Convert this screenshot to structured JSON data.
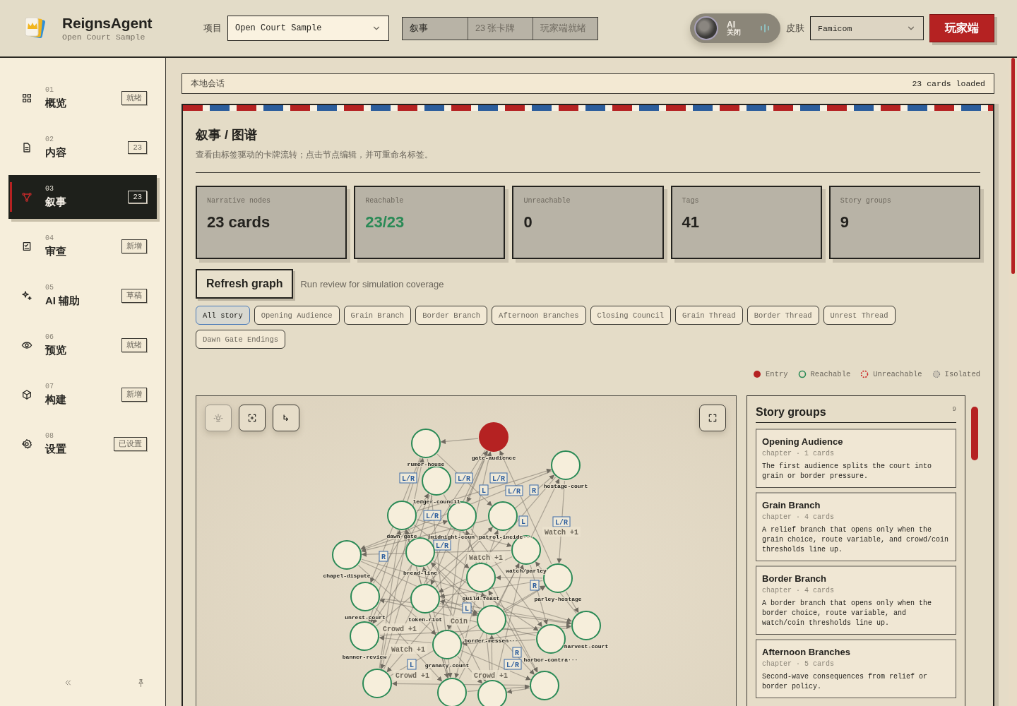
{
  "app": {
    "title": "ReignsAgent",
    "subtitle": "Open Court Sample"
  },
  "project": {
    "label": "项目",
    "value": "Open Court Sample"
  },
  "status_segments": [
    {
      "text": "叙事",
      "selected": true
    },
    {
      "text": "23 张卡牌",
      "selected": false
    },
    {
      "text": "玩家端就绪",
      "selected": false
    }
  ],
  "ai_toggle": {
    "label": "AI",
    "state_text": "关闭",
    "on": false
  },
  "skin": {
    "label": "皮肤",
    "value": "Famicom"
  },
  "player_button": "玩家端",
  "sidebar": {
    "items": [
      {
        "number": "01",
        "label": "概览",
        "badge": "就绪",
        "selected": false
      },
      {
        "number": "02",
        "label": "内容",
        "badge": "23",
        "selected": false
      },
      {
        "number": "03",
        "label": "叙事",
        "badge": "23",
        "selected": true
      },
      {
        "number": "04",
        "label": "审查",
        "badge": "新增",
        "selected": false
      },
      {
        "number": "05",
        "label": "AI 辅助",
        "badge": "草稿",
        "selected": false
      },
      {
        "number": "06",
        "label": "预览",
        "badge": "就绪",
        "selected": false
      },
      {
        "number": "07",
        "label": "构建",
        "badge": "新增",
        "selected": false
      },
      {
        "number": "08",
        "label": "设置",
        "badge": "已设置",
        "selected": false
      }
    ]
  },
  "session_bar": {
    "title": "本地会话",
    "status": "23 cards loaded"
  },
  "panel": {
    "title": "叙事 / 图谱",
    "subtitle": "查看由标签驱动的卡牌流转；点击节点编辑，并可重命名标签。"
  },
  "stats": [
    {
      "label": "Narrative nodes",
      "value": "23 cards",
      "kind": "plain"
    },
    {
      "label": "Reachable",
      "value": "23/23",
      "kind": "good"
    },
    {
      "label": "Unreachable",
      "value": "0",
      "kind": "plain"
    },
    {
      "label": "Tags",
      "value": "41",
      "kind": "plain"
    },
    {
      "label": "Story groups",
      "value": "9",
      "kind": "plain"
    }
  ],
  "refresh_button": "Refresh graph",
  "refresh_hint": "Run review for simulation coverage",
  "filters": [
    {
      "label": "All story",
      "selected": true
    },
    {
      "label": "Opening Audience",
      "selected": false
    },
    {
      "label": "Grain Branch",
      "selected": false
    },
    {
      "label": "Border Branch",
      "selected": false
    },
    {
      "label": "Afternoon Branches",
      "selected": false
    },
    {
      "label": "Closing Council",
      "selected": false
    },
    {
      "label": "Grain Thread",
      "selected": false
    },
    {
      "label": "Border Thread",
      "selected": false
    },
    {
      "label": "Unrest Thread",
      "selected": false
    },
    {
      "label": "Dawn Gate Endings",
      "selected": false
    }
  ],
  "legend": [
    {
      "label": "Entry",
      "kind": "entry"
    },
    {
      "label": "Reachable",
      "kind": "reachable"
    },
    {
      "label": "Unreachable",
      "kind": "unreachable"
    },
    {
      "label": "Isolated",
      "kind": "isolated"
    }
  ],
  "graph": {
    "nodes": [
      {
        "label": "gate-audience",
        "kind": "entry"
      },
      {
        "label": "rumor-house",
        "kind": "reachable"
      },
      {
        "label": "hostage-court",
        "kind": "reachable"
      },
      {
        "label": "ledger-council",
        "kind": "reachable"
      },
      {
        "label": "dawn-gate",
        "kind": "reachable"
      },
      {
        "label": "midnight-coun",
        "kind": "reachable"
      },
      {
        "label": "patrol-incide···",
        "kind": "reachable"
      },
      {
        "label": "watch/parley",
        "kind": "reachable"
      },
      {
        "label": "chapel-dispute",
        "kind": "reachable"
      },
      {
        "label": "bread-line",
        "kind": "reachable"
      },
      {
        "label": "guild-feast",
        "kind": "reachable"
      },
      {
        "label": "parley-hostage",
        "kind": "reachable"
      },
      {
        "label": "unrest-court",
        "kind": "reachable"
      },
      {
        "label": "token-riot",
        "kind": "reachable"
      },
      {
        "label": "border-messen···",
        "kind": "reachable"
      },
      {
        "label": "harvest-court",
        "kind": "reachable"
      },
      {
        "label": "banner-review",
        "kind": "reachable"
      },
      {
        "label": "harbor-contra···",
        "kind": "reachable"
      },
      {
        "label": "granary-count",
        "kind": "reachable"
      },
      {
        "kind": "reachable"
      },
      {
        "kind": "reachable"
      },
      {
        "kind": "reachable"
      },
      {
        "kind": "reachable"
      }
    ],
    "edge_labels": [
      {
        "text": "L/R",
        "kind": "badge"
      },
      {
        "text": "L/R",
        "kind": "badge"
      },
      {
        "text": "L/R",
        "kind": "badge"
      },
      {
        "text": "L",
        "kind": "badge"
      },
      {
        "text": "L/R",
        "kind": "badge"
      },
      {
        "text": "R",
        "kind": "badge"
      },
      {
        "text": "L/R",
        "kind": "badge"
      },
      {
        "text": "L",
        "kind": "badge"
      },
      {
        "text": "L/R",
        "kind": "badge"
      },
      {
        "text": "Watch +1",
        "kind": "effect"
      },
      {
        "text": "L/R",
        "kind": "badge"
      },
      {
        "text": "R",
        "kind": "badge"
      },
      {
        "text": "Watch +1",
        "kind": "effect"
      },
      {
        "text": "R",
        "kind": "badge"
      },
      {
        "text": "L",
        "kind": "badge"
      },
      {
        "text": "Coin",
        "kind": "effect"
      },
      {
        "text": "Crowd +1",
        "kind": "effect"
      },
      {
        "text": "Watch +1",
        "kind": "effect"
      },
      {
        "text": "R",
        "kind": "badge"
      },
      {
        "text": "L",
        "kind": "badge"
      },
      {
        "text": "L/R",
        "kind": "badge"
      },
      {
        "text": "Crowd +1",
        "kind": "effect"
      },
      {
        "text": "Crowd +1",
        "kind": "effect"
      }
    ]
  },
  "story_groups": {
    "title": "Story groups",
    "count": "9",
    "items": [
      {
        "name": "Opening Audience",
        "meta": "chapter · 1 cards",
        "description": "The first audience splits the court into grain or border pressure."
      },
      {
        "name": "Grain Branch",
        "meta": "chapter · 4 cards",
        "description": "A relief branch that opens only when the grain choice, route variable, and crowd/coin thresholds line up."
      },
      {
        "name": "Border Branch",
        "meta": "chapter · 4 cards",
        "description": "A border branch that opens only when the border choice, route variable, and watch/coin thresholds line up."
      },
      {
        "name": "Afternoon Branches",
        "meta": "chapter · 5 cards",
        "description": "Second-wave consequences from relief or border policy."
      }
    ]
  }
}
